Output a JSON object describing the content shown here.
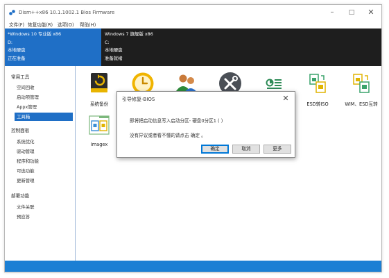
{
  "window": {
    "title": "Dism++x86 10.1.1002.1 Bios Firmware"
  },
  "menu": [
    "文件(F)",
    "恢复功能(R)",
    "选项(O)",
    "帮助(H)"
  ],
  "os_panels": [
    {
      "name": "*Windows 10 专业版 x86",
      "drive": "D:",
      "type": "本地硬盘",
      "status": "正在准备"
    },
    {
      "name": "Windows 7 旗舰版 x86",
      "drive": "C:",
      "type": "本地硬盘",
      "status": "准备就绪"
    }
  ],
  "sidebar": {
    "sections": [
      {
        "title": "常用工具",
        "items": [
          "空间回收",
          "启动项管理",
          "Appx管理",
          "工具箱"
        ]
      },
      {
        "title": "控制面板",
        "items": [
          "系统优化",
          "驱动管理",
          "程序和功能",
          "可选功能",
          "更新管理"
        ]
      },
      {
        "title": "部署功能",
        "items": [
          "文件关联",
          "预应答"
        ]
      }
    ],
    "selected": "工具箱"
  },
  "tools": [
    {
      "label": "系统备份",
      "icon": "backup-drive-icon"
    },
    {
      "label": "",
      "icon": "clock-icon"
    },
    {
      "label": "",
      "icon": "users-icon"
    },
    {
      "label": "",
      "icon": "tools-icon"
    },
    {
      "label": "",
      "icon": "toggle-list-icon"
    },
    {
      "label": "ESD转ISO",
      "icon": "esd-iso-icon"
    },
    {
      "label": "WIM、ESD互转",
      "icon": "wim-esd-icon"
    },
    {
      "label": "Imagex",
      "icon": "imagex-icon"
    }
  ],
  "dialog": {
    "title": "引导修复-BIOS",
    "line1": "即将把启动信息写入启动分区- 硬盘0分区1 ( )",
    "line2": "没有异议或者看不懂的请点击 确定 。",
    "ok": "确定",
    "cancel": "取消",
    "more": "更多"
  },
  "colors": {
    "accent": "#1f6fc6",
    "status_bar": "#1b7fd4",
    "os_bar": "#1e1e1e"
  }
}
